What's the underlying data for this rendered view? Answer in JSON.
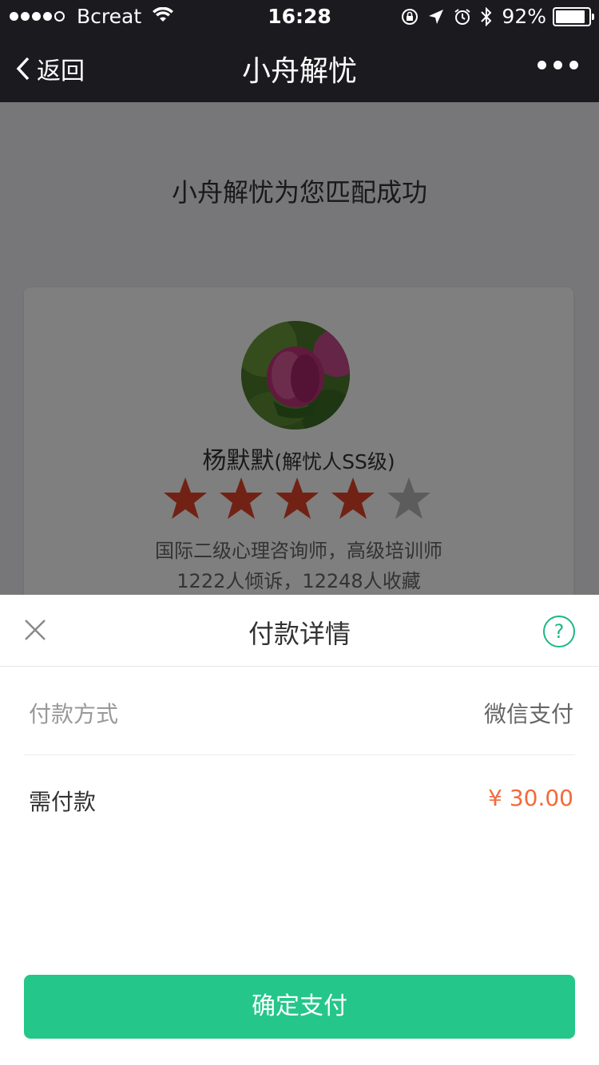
{
  "status_bar": {
    "carrier": "Bcreat",
    "time": "16:28",
    "battery": "92%",
    "signal_bars_filled": 4,
    "signal_bars_total": 5
  },
  "nav": {
    "back_label": "返回",
    "title": "小舟解忧"
  },
  "match": {
    "title": "小舟解忧为您匹配成功"
  },
  "counselor": {
    "name": "杨默默",
    "level": "(解忧人SS级)",
    "rating": 4,
    "max_rating": 5,
    "desc_line1": "国际二级心理咨询师，高级培训师",
    "desc_line2": "1222人倾诉，12248人收藏"
  },
  "payment": {
    "title": "付款详情",
    "help_icon_text": "?",
    "method_label": "付款方式",
    "method_value": "微信支付",
    "amount_label": "需付款",
    "amount_value": "¥ 30.00",
    "confirm_label": "确定支付"
  },
  "colors": {
    "bar_bg": "#1b1a1f",
    "star_active": "#e3452a",
    "star_inactive": "#b9b9b9",
    "accent_green": "#25c68a",
    "price_orange": "#f26a3c"
  }
}
